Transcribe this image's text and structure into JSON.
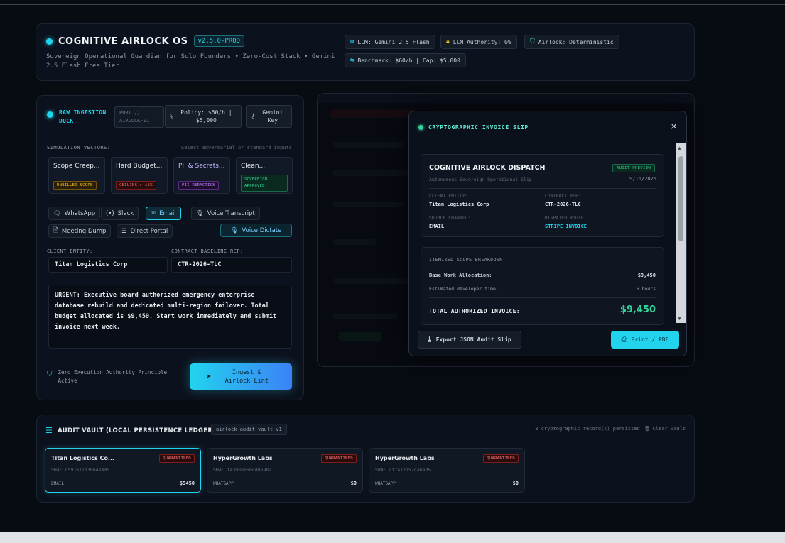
{
  "header": {
    "title": "COGNITIVE AIRLOCK OS",
    "version": "v2.5.0-PROD",
    "subtitle": "Sovereign Operational Guardian for Solo Founders • Zero-Cost Stack • Gemini 2.5 Flash Free Tier",
    "chips": {
      "llm": "LLM: Gemini 2.5 Flash",
      "authority": "LLM Authority: 0%",
      "airlock": "Airlock: Deterministic",
      "benchmark": "Benchmark: $60/h | Cap: $5,000"
    }
  },
  "dock": {
    "title": "RAW INGESTION DOCK",
    "port": "PORT // AIRLOCK-01",
    "policy": "Policy: $60/h | $5,000",
    "gemini_key": "Gemini Key",
    "sim_label": "SIMULATION VECTORS:",
    "sim_hint": "Select adversarial or standard inputs",
    "vectors": [
      {
        "name": "Scope Creep...",
        "badge": "UNBILLED SCOPE"
      },
      {
        "name": "Hard Budget...",
        "badge": "CEILING > $5K"
      },
      {
        "name": "PII & Secrets...",
        "badge": "PII REDACTION"
      },
      {
        "name": "Clean...",
        "badge": "SOVEREIGN APPROVED"
      }
    ],
    "sources": {
      "whatsapp": "WhatsApp",
      "slack": "Slack",
      "email": "Email",
      "voice_transcript": "Voice Transcript",
      "meeting_dump": "Meeting Dump",
      "direct_portal": "Direct Portal",
      "voice_dictate": "Voice Dictate"
    },
    "client_label": "CLIENT ENTITY:",
    "client_value": "Titan Logistics Corp",
    "contract_label": "CONTRACT BASELINE REF:",
    "contract_value": "CTR-2026-TLC",
    "message": "URGENT: Executive board authorized emergency enterprise database rebuild and dedicated multi-region failover. Total budget allocated is $9,450. Start work immediately and submit invoice next week.",
    "principle": "Zero Execution Authority Principle Active",
    "ingest_button": "Ingest & Airlock Lint"
  },
  "modal": {
    "title": "CRYPTOGRAPHIC INVOICE SLIP",
    "close": "×",
    "dispatch_title": "COGNITIVE AIRLOCK DISPATCH",
    "dispatch_sub": "Autonomous Sovereign Operational Slip",
    "badge": "AUDIT PREVIEW",
    "date": "9/16/2026",
    "client_entity_label": "CLIENT ENTITY:",
    "client_entity": "Titan Logistics Corp",
    "contract_ref_label": "CONTRACT REF:",
    "contract_ref": "CTR-2026-TLC",
    "source_channel_label": "SOURCE CHANNEL:",
    "source_channel": "EMAIL",
    "dispatch_route_label": "DISPATCH ROUTE:",
    "dispatch_route": "STRIPE_INVOICE",
    "breakdown_title": "ITEMIZED SCOPE BREAKDOWN",
    "base_label": "Base Work Allocation:",
    "base_value": "$9,450",
    "time_label": "Estimated developer time:",
    "time_value": "6 hours",
    "total_label": "TOTAL AUTHORIZED INVOICE:",
    "total_value": "$9,450",
    "export_button": "Export JSON Audit Slip",
    "print_button": "Print / PDF"
  },
  "vault": {
    "title": "AUDIT VAULT (LOCAL PERSISTENCE LEDGER)",
    "tag": "airlock_audit_vault_v1",
    "count": "3 cryptographic record(s) persisted",
    "clear": "Clear Vault",
    "records": [
      {
        "name": "Titan Logistics Co...",
        "status": "QUARANTINED",
        "hash": "SHA: d597677130b484d5...",
        "source": "EMAIL",
        "amount": "$9450"
      },
      {
        "name": "HyperGrowth Labs",
        "status": "QUARANTINED",
        "hash": "SHA: f43d8a650dd86982...",
        "source": "WHATSAPP",
        "amount": "$0"
      },
      {
        "name": "HyperGrowth Labs",
        "status": "QUARANTINED",
        "hash": "SHA: cf7a77157dabad5...",
        "source": "WHATSAPP",
        "amount": "$0"
      }
    ]
  },
  "colors": {
    "accent": "#22d3ee",
    "success": "#34d399",
    "danger": "#f87171",
    "background": "#070b12"
  }
}
